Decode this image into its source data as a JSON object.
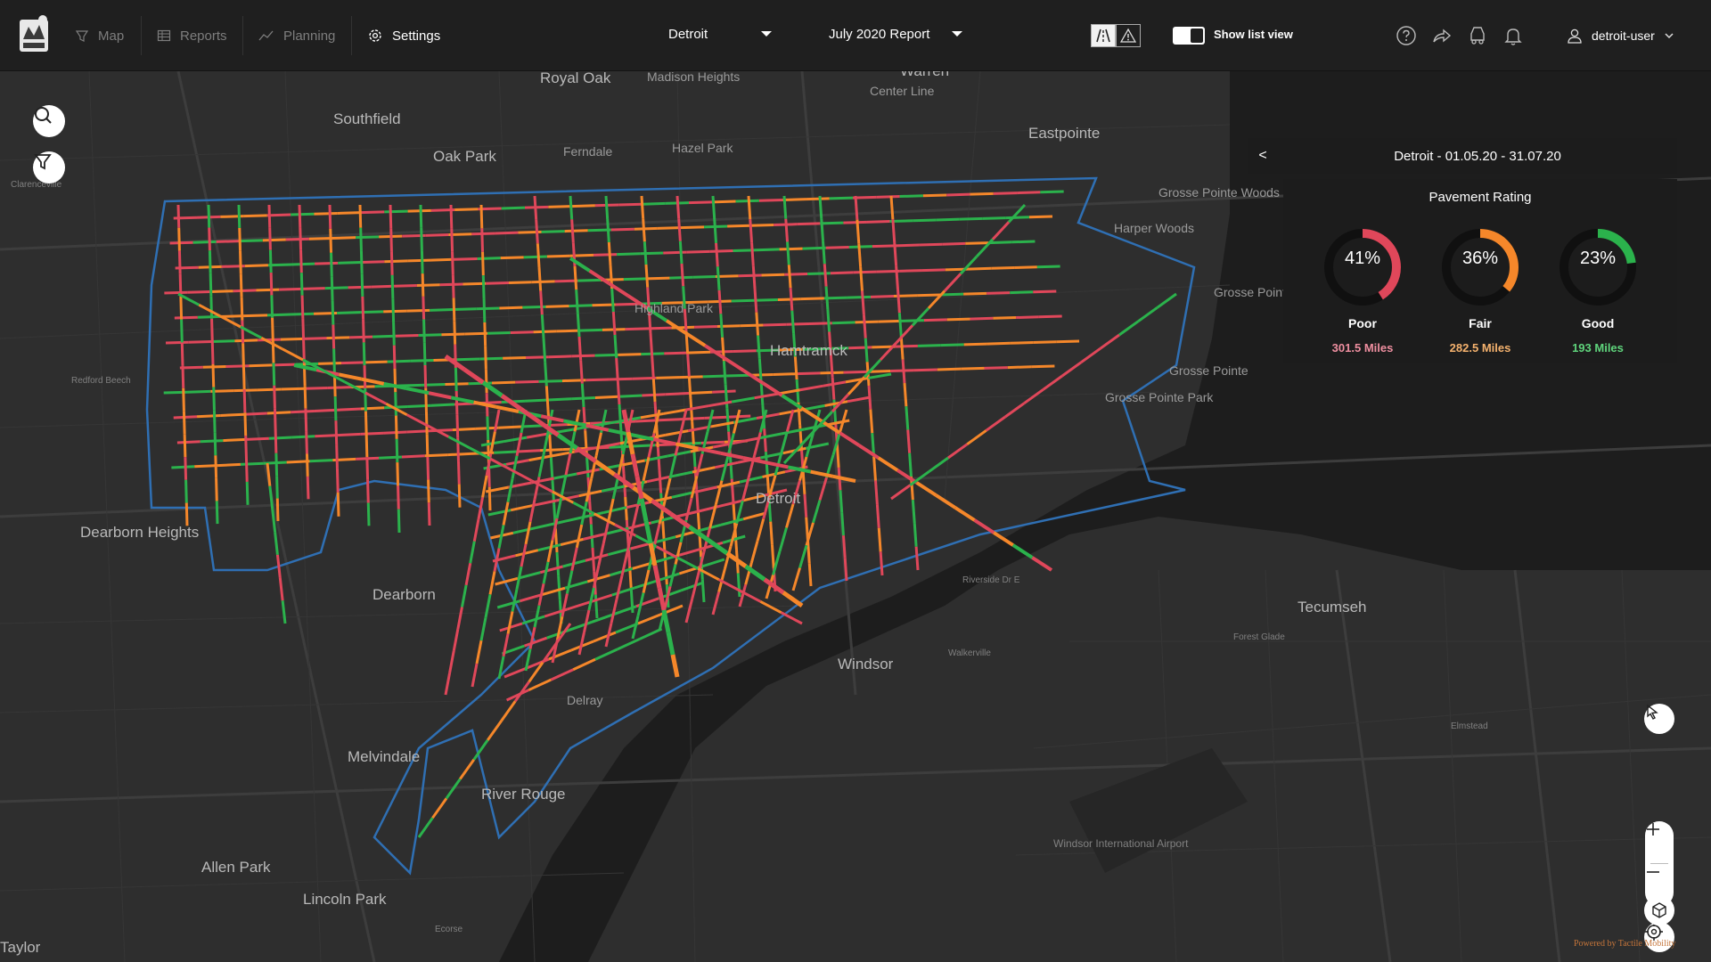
{
  "nav": {
    "items": [
      {
        "label": "Map",
        "icon": "map-pin-icon",
        "active": false
      },
      {
        "label": "Reports",
        "icon": "reports-grid-icon",
        "active": false
      },
      {
        "label": "Planning",
        "icon": "trend-chart-icon",
        "active": false
      },
      {
        "label": "Settings",
        "icon": "gear-icon",
        "active": true
      }
    ]
  },
  "header": {
    "city_select": "Detroit",
    "report_select": "July 2020 Report",
    "show_list_view": "Show list view",
    "username": "detroit-user"
  },
  "panel": {
    "header": "Detroit - 01.05.20 - 31.07.20",
    "collapse_glyph": "<",
    "title": "Pavement Rating",
    "ratings": [
      {
        "percent_label": "41%",
        "percent": 0.41,
        "label": "Poor",
        "miles": "301.5 Miles",
        "color": "#e0475a"
      },
      {
        "percent_label": "36%",
        "percent": 0.36,
        "label": "Fair",
        "miles": "282.5 Miles",
        "color": "#f5872a"
      },
      {
        "percent_label": "23%",
        "percent": 0.23,
        "label": "Good",
        "miles": "193 Miles",
        "color": "#2bb24c"
      }
    ]
  },
  "map_labels": [
    "Royal Oak",
    "Madison Heights",
    "Warren",
    "Center Line",
    "Southfield",
    "Oak Park",
    "Ferndale",
    "Hazel Park",
    "Eastpointe",
    "Grosse Pointe Woods",
    "Harper Woods",
    "Highland Park",
    "Hamtramck",
    "Grosse Pointe Farms",
    "Grosse Pointe",
    "Grosse Pointe Park",
    "Redford Beech",
    "Detroit",
    "Dearborn Heights",
    "Dearborn",
    "Windsor",
    "Tecumseh",
    "Melvindale",
    "River Rouge",
    "Allen Park",
    "Lincoln Park",
    "Windsor International Airport",
    "Taylor",
    "Clarenceville",
    "Delray",
    "Riverside Dr E",
    "Walkerville",
    "Elmstead",
    "Forest Glade",
    "Ecorse"
  ],
  "colors": {
    "poor": "#e0475a",
    "fair": "#f5872a",
    "good": "#2bb24c",
    "boundary": "#2f6fb3",
    "water": "#1c1c1c",
    "land": "#2e2e2e"
  },
  "footer": {
    "powered_by": "Powered by Tactile Mobility"
  }
}
